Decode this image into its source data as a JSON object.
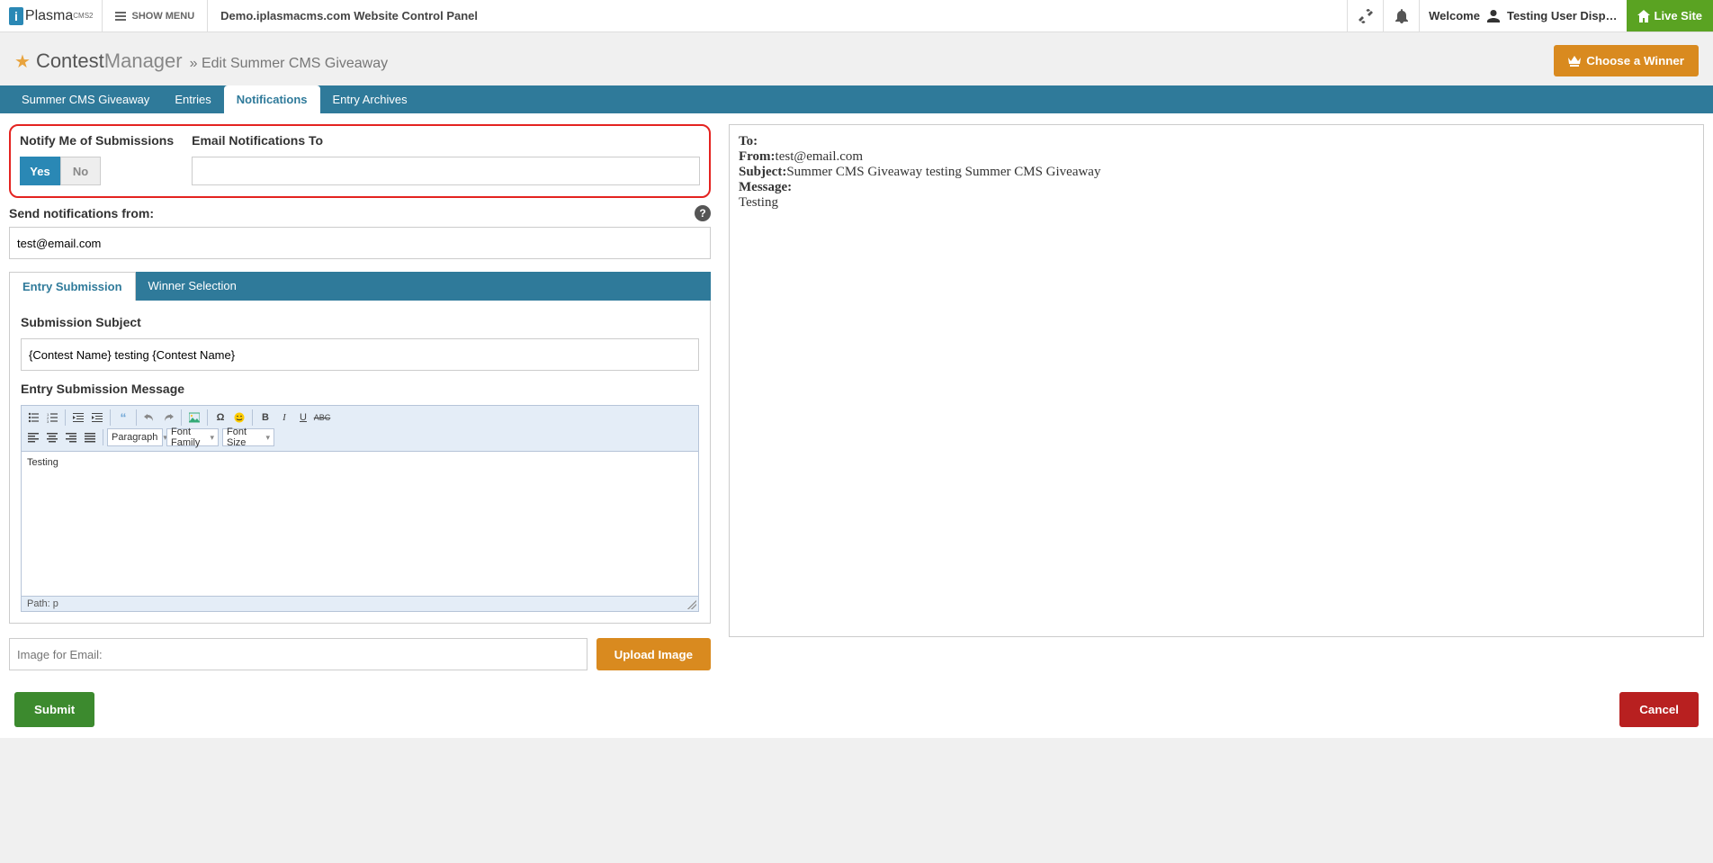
{
  "topbar": {
    "logo_main": "Plasma",
    "logo_suffix": "CMS2",
    "show_menu": "SHOW MENU",
    "site_title": "Demo.iplasmacms.com Website Control Panel",
    "welcome": "Welcome",
    "user": "Testing User Disp…",
    "live_site": "Live Site"
  },
  "header": {
    "app": "Contest",
    "app2": "Manager",
    "sep": "»",
    "breadcrumb": "Edit Summer CMS Giveaway",
    "choose_winner": "Choose a Winner"
  },
  "main_tabs": [
    "Summer CMS Giveaway",
    "Entries",
    "Notifications",
    "Entry Archives"
  ],
  "main_tabs_active": 2,
  "form": {
    "notify_label": "Notify Me of Submissions",
    "yes": "Yes",
    "no": "No",
    "email_to_label": "Email Notifications To",
    "email_to_value": "",
    "send_from_label": "Send notifications from:",
    "send_from_value": "test@email.com",
    "sub_tabs": [
      "Entry Submission",
      "Winner Selection"
    ],
    "sub_tabs_active": 0,
    "subject_label": "Submission Subject",
    "subject_value": "{Contest Name} testing {Contest Name}",
    "message_label": "Entry Submission Message",
    "editor_body": "Testing",
    "editor_path": "Path: p",
    "paragraph_sel": "Paragraph",
    "fontfam_sel": "Font Family",
    "fontsize_sel": "Font Size",
    "image_placeholder": "Image for Email:",
    "upload_btn": "Upload Image",
    "submit": "Submit",
    "cancel": "Cancel"
  },
  "preview": {
    "to_label": "To:",
    "to_value": "",
    "from_label": "From:",
    "from_value": "test@email.com",
    "subject_label": "Subject:",
    "subject_value": "Summer CMS Giveaway testing Summer CMS Giveaway",
    "message_label": "Message:",
    "message_value": "Testing"
  }
}
